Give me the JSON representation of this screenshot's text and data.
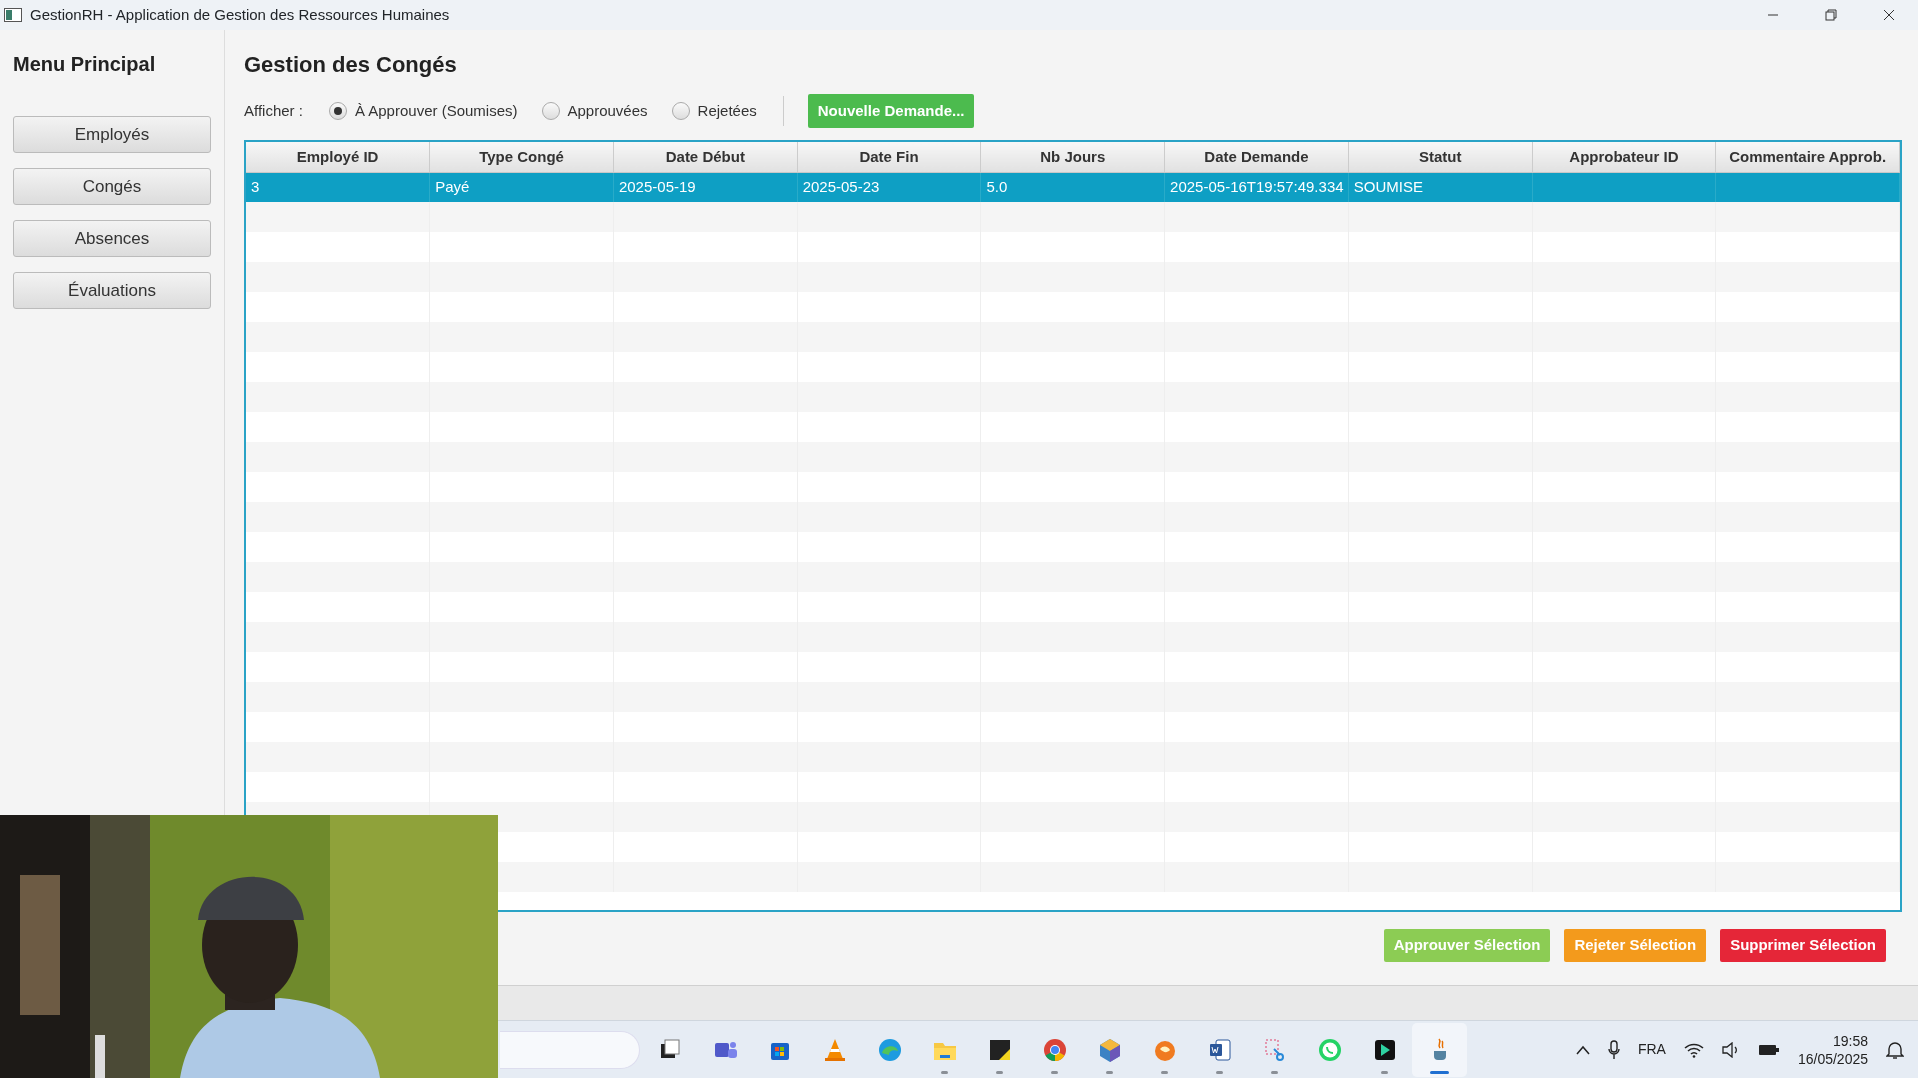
{
  "window": {
    "title": "GestionRH - Application de Gestion des Ressources Humaines"
  },
  "sidebar": {
    "title": "Menu Principal",
    "items": [
      {
        "label": "Employés"
      },
      {
        "label": "Congés"
      },
      {
        "label": "Absences"
      },
      {
        "label": "Évaluations"
      }
    ]
  },
  "page": {
    "title": "Gestion des Congés"
  },
  "filter": {
    "label": "Afficher :",
    "options": [
      {
        "label": "À Approuver (Soumises)",
        "selected": true
      },
      {
        "label": "Approuvées",
        "selected": false
      },
      {
        "label": "Rejetées",
        "selected": false
      }
    ]
  },
  "new_button": "Nouvelle Demande...",
  "table": {
    "columns": [
      "Employé ID",
      "Type Congé",
      "Date Début",
      "Date Fin",
      "Nb Jours",
      "Date Demande",
      "Statut",
      "Approbateur ID",
      "Commentaire Approb."
    ],
    "rows": [
      {
        "selected": true,
        "cells": [
          "3",
          "Payé",
          "2025-05-19",
          "2025-05-23",
          "5.0",
          "2025-05-16T19:57:49.334",
          "SOUMISE",
          "",
          ""
        ]
      }
    ]
  },
  "actions": [
    {
      "label": "Approuver Sélection",
      "kind": "approve"
    },
    {
      "label": "Rejeter Sélection",
      "kind": "reject"
    },
    {
      "label": "Supprimer Sélection",
      "kind": "delete"
    }
  ],
  "taskbar": {
    "apps": [
      {
        "kind": "taskview",
        "running": false,
        "active": false
      },
      {
        "kind": "teams",
        "running": false,
        "active": false
      },
      {
        "kind": "store",
        "running": false,
        "active": false
      },
      {
        "kind": "cone",
        "running": false,
        "active": false
      },
      {
        "kind": "browser",
        "running": false,
        "active": false
      },
      {
        "kind": "folder",
        "running": true,
        "active": false
      },
      {
        "kind": "note",
        "running": true,
        "active": false
      },
      {
        "kind": "chrome",
        "running": true,
        "active": false
      },
      {
        "kind": "cube",
        "running": true,
        "active": false
      },
      {
        "kind": "orange",
        "running": true,
        "active": false
      },
      {
        "kind": "word",
        "running": true,
        "active": false
      },
      {
        "kind": "snip",
        "running": true,
        "active": false
      },
      {
        "kind": "chat",
        "running": false,
        "active": false
      },
      {
        "kind": "editor",
        "running": true,
        "active": false
      },
      {
        "kind": "java",
        "running": true,
        "active": true
      }
    ],
    "language": "FRA",
    "time": "19:58",
    "date": "16/05/2025"
  }
}
